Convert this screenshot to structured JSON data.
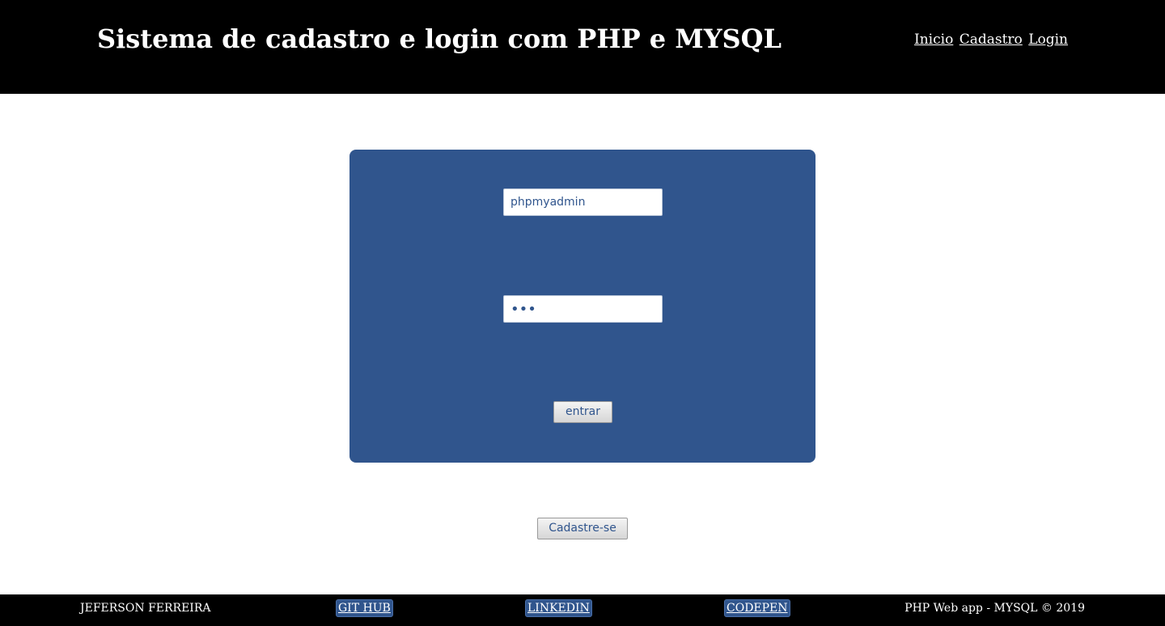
{
  "header": {
    "title": "Sistema de cadastro e login com PHP e MYSQL",
    "nav": {
      "inicio": "Inicio",
      "cadastro": "Cadastro",
      "login": "Login"
    }
  },
  "login_form": {
    "username_value": "phpmyadmin",
    "password_value": "abc",
    "submit_label": "entrar"
  },
  "register_button_label": "Cadastre-se",
  "footer": {
    "author": "JEFERSON FERREIRA",
    "links": {
      "github": "GIT HUB",
      "linkedin": "LINKEDIN",
      "codepen": "CODEPEN"
    },
    "copyright": "PHP Web app - MYSQL © 2019"
  },
  "colors": {
    "header_bg": "#000000",
    "panel_bg": "#30558d",
    "footer_bg": "#000000"
  }
}
